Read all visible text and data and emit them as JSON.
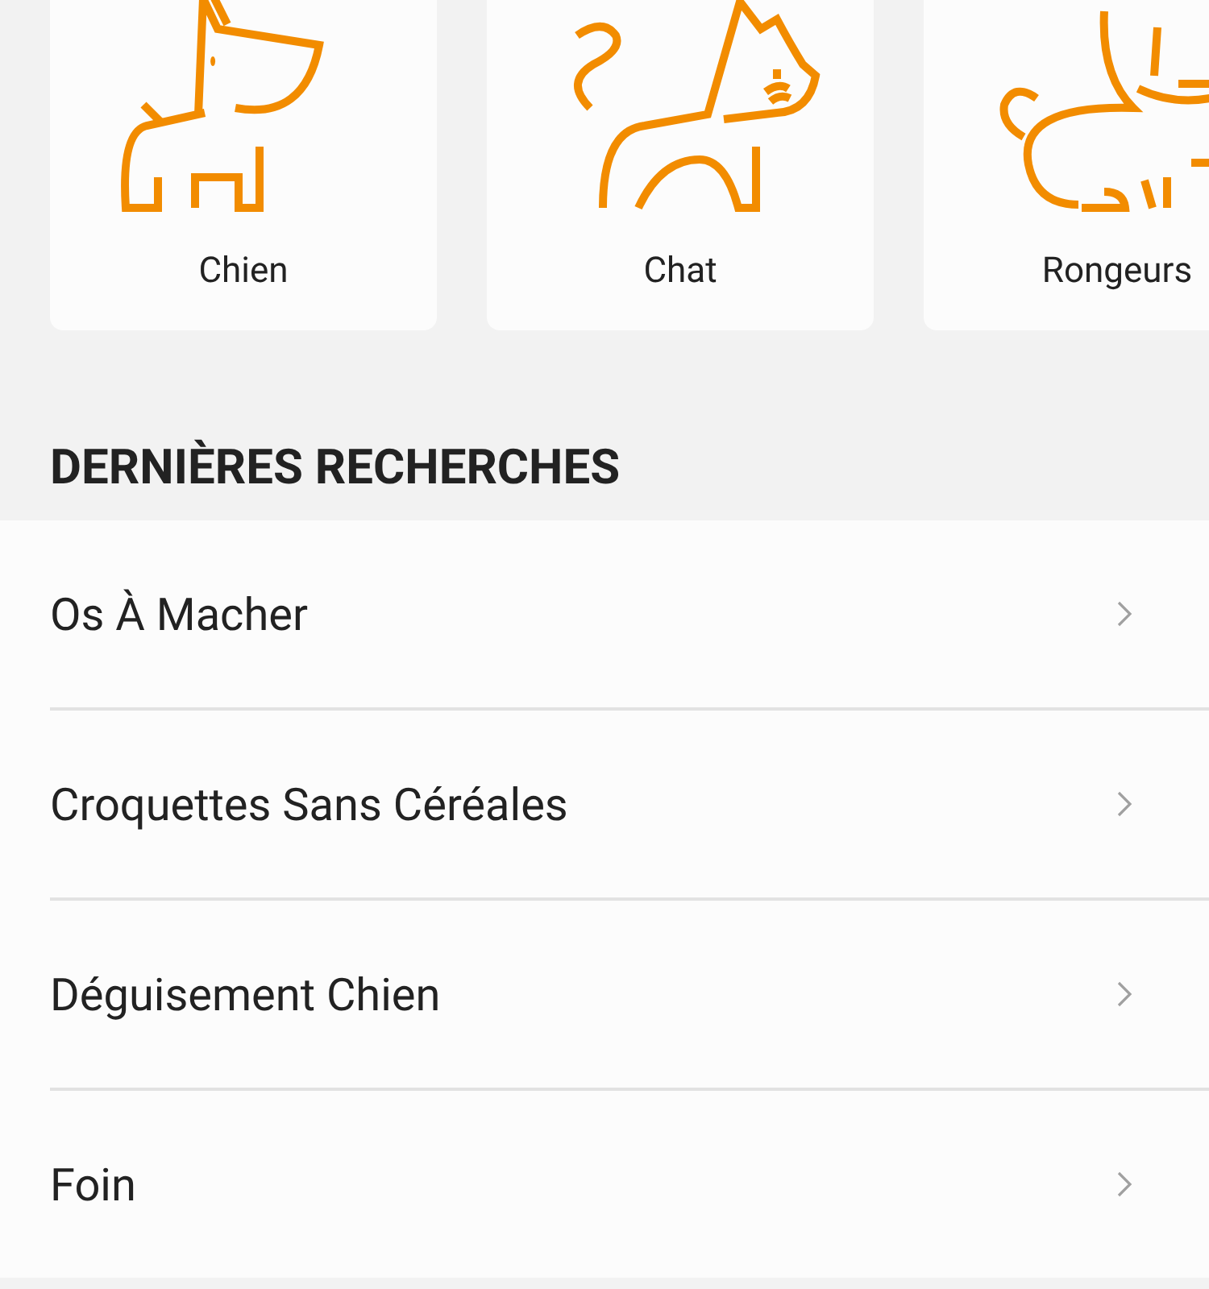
{
  "categories": [
    {
      "label": "Chien",
      "kind": "dog"
    },
    {
      "label": "Chat",
      "kind": "cat"
    },
    {
      "label": "Rongeurs",
      "kind": "rodent"
    }
  ],
  "recent_searches": {
    "title": "DERNIÈRES RECHERCHES",
    "items": [
      {
        "label": "Os À Macher"
      },
      {
        "label": "Croquettes Sans Céréales"
      },
      {
        "label": "Déguisement Chien"
      },
      {
        "label": "Foin"
      }
    ]
  }
}
